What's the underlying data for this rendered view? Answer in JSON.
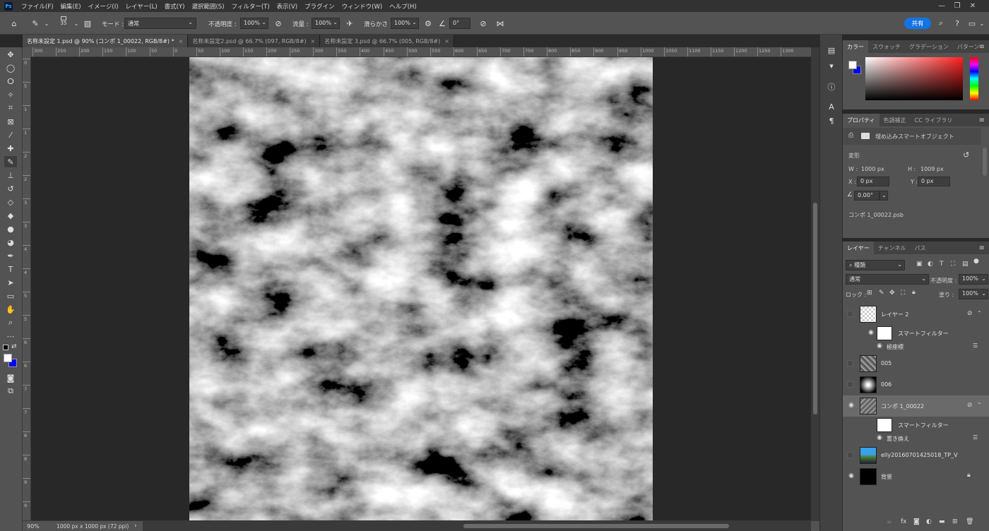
{
  "menubar": {
    "logo": "Ps",
    "items": [
      "ファイル(F)",
      "編集(E)",
      "イメージ(I)",
      "レイヤー(L)",
      "書式(Y)",
      "選択範囲(S)",
      "フィルター(T)",
      "表示(V)",
      "プラグイン",
      "ウィンドウ(W)",
      "ヘルプ(H)"
    ],
    "minimize": "—",
    "maximize": "❐",
    "close": "✕"
  },
  "options": {
    "brush_size": "35",
    "mode_label": "モード :",
    "mode_value": "通常",
    "opacity_label": "不透明度 :",
    "opacity_value": "100%",
    "flow_label": "流量 :",
    "flow_value": "100%",
    "smoothing_label": "滑らかさ :",
    "smoothing_value": "100%",
    "angle_value": "0°",
    "share_label": "共有"
  },
  "tabs": [
    {
      "label": "名称未設定 1.psd @ 90% (コンポ 1_00022, RGB/8#) *",
      "close": "×",
      "active": true
    },
    {
      "label": "名称未設定2.psd @ 66.7% (097, RGB/8#)",
      "close": "×",
      "active": false
    },
    {
      "label": "名称未設定 3.psd @ 66.7% (005, RGB/8#)",
      "close": "×",
      "active": false
    }
  ],
  "ruler_top_labels": [
    "300",
    "250",
    "200",
    "150",
    "100",
    "50",
    "0",
    "50",
    "100",
    "150",
    "200",
    "250",
    "300",
    "350",
    "400",
    "450",
    "500",
    "550",
    "600",
    "650",
    "700",
    "750",
    "800",
    "850",
    "900",
    "950",
    "1000",
    "1050",
    "1100",
    "1150",
    "1200",
    "1250",
    "1300"
  ],
  "ruler_left_labels": [
    "0",
    "5",
    "1",
    "1",
    "2",
    "2",
    "3",
    "3",
    "4",
    "4",
    "5",
    "5",
    "6",
    "6",
    "7",
    "7",
    "8",
    "8",
    "9",
    "9"
  ],
  "status": {
    "zoom": "90%",
    "doc_size": "1000 px x 1000 px (72 ppi)",
    "arrow": "›"
  },
  "color_panel": {
    "tabs": [
      "カラー",
      "スウォッチ",
      "グラデーション",
      "パターン"
    ],
    "foreground": "#ffffff",
    "background": "#0000ff"
  },
  "properties_panel": {
    "tabs": [
      "プロパティ",
      "色調補正",
      "CC ライブラリ"
    ],
    "object_type": "埋め込みスマートオブジェクト",
    "section_transform": "変形",
    "w_label": "W :",
    "w_value": "1000 px",
    "h_label": "H :",
    "h_value": "1009 px",
    "x_label": "X :",
    "x_value": "0 px",
    "y_label": "Y :",
    "y_value": "0 px",
    "angle_value": "0.00°",
    "linked_file": "コンポ 1_00022.psb"
  },
  "layers_panel": {
    "tabs": [
      "レイヤー",
      "チャンネル",
      "パス"
    ],
    "filter_kind": "種類",
    "blend_mode": "通常",
    "opacity_label": "不透明度 :",
    "opacity_value": "100%",
    "lock_label": "ロック :",
    "fill_label": "塗り :",
    "fill_value": "100%",
    "layers": [
      {
        "name": "レイヤー 2",
        "visible": false,
        "type": "smart"
      },
      {
        "name": "スマートフィルター",
        "visible": true,
        "type": "filter-mask"
      },
      {
        "name": "極座標",
        "visible": true,
        "type": "filter"
      },
      {
        "name": "005",
        "visible": false,
        "type": "pixel"
      },
      {
        "name": "006",
        "visible": false,
        "type": "pixel"
      },
      {
        "name": "コンポ 1_00022",
        "visible": true,
        "type": "smart",
        "selected": true
      },
      {
        "name": "スマートフィルター",
        "visible": true,
        "type": "filter-mask"
      },
      {
        "name": "置き換え",
        "visible": true,
        "type": "filter"
      },
      {
        "name": "elly20160701425018_TP_V",
        "visible": false,
        "type": "pixel"
      },
      {
        "name": "背景",
        "visible": true,
        "type": "background"
      }
    ]
  }
}
